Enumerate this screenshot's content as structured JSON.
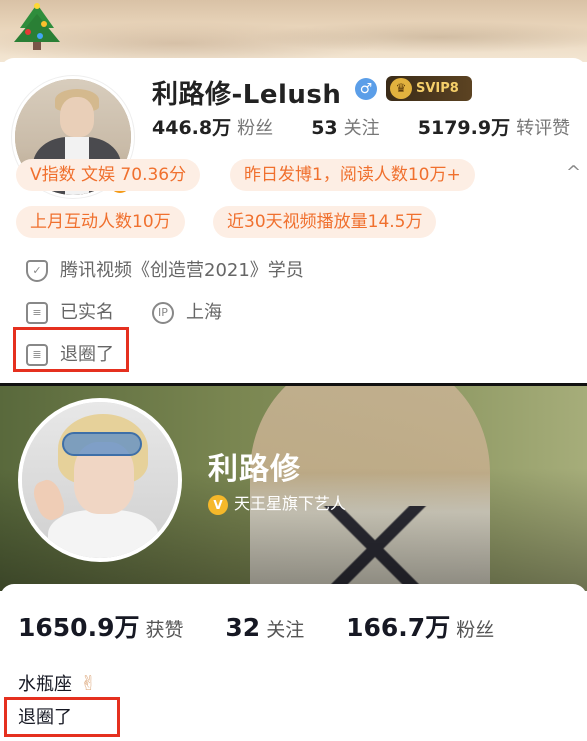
{
  "top_profile": {
    "name": "利路修-Lelush",
    "gender_icon": "male-icon",
    "gender_glyph": "♂",
    "vip_label": "SVIP8",
    "verified_glyph": "V",
    "stats": [
      {
        "value": "446.8万",
        "label": "粉丝"
      },
      {
        "value": "53",
        "label": "关注"
      },
      {
        "value": "5179.9万",
        "label": "转评赞"
      }
    ],
    "tags": [
      "V指数 文娱 70.36分",
      "昨日发博1，阅读人数10万+",
      "上月互动人数10万",
      "近30天视频播放量14.5万"
    ],
    "collapse_glyph": "^",
    "info": {
      "identity": "腾讯视频《创造营2021》学员",
      "real_name": "已实名",
      "ip_glyph": "IP",
      "ip_location": "上海",
      "bio": "退圈了"
    }
  },
  "bottom_profile": {
    "name": "利路修",
    "verified_glyph": "V",
    "verification": "天王星旗下艺人",
    "stats": [
      {
        "value": "1650.9万",
        "label": "获赞"
      },
      {
        "value": "32",
        "label": "关注"
      },
      {
        "value": "166.7万",
        "label": "粉丝"
      }
    ],
    "zodiac": "水瓶座",
    "zodiac_emoji": "✌",
    "bio": "退圈了"
  },
  "colors": {
    "highlight_box": "#e5301f",
    "tag_text": "#f0702e",
    "tag_bg": "#fdeee4",
    "verified_orange": "#f39a16"
  }
}
